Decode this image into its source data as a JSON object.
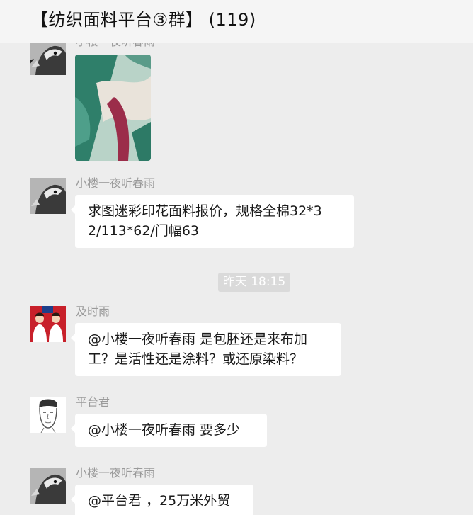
{
  "header": {
    "title": "【纺织面料平台③群】 (119)"
  },
  "colors": {
    "background": "#ededed",
    "bubble": "#ffffff",
    "sender_text": "#9a9a9a",
    "time_badge": "#dadada"
  },
  "messages": [
    {
      "type": "image",
      "sender": "小楼一夜听春雨",
      "avatar": "eagle-avatar"
    },
    {
      "type": "text",
      "sender": "小楼一夜听春雨",
      "avatar": "eagle-avatar",
      "text": "求图迷彩印花面料报价，规格全棉32*3\n2/113*62/门幅63"
    },
    {
      "type": "time",
      "text": "昨天 18:15"
    },
    {
      "type": "text",
      "sender": "及时雨",
      "avatar": "couple-avatar",
      "text": "@小楼一夜听春雨 是包胚还是来布加\n工？是活性还是涂料？或还原染料？"
    },
    {
      "type": "text",
      "sender": "平台君",
      "avatar": "sketch-face-avatar",
      "text": "@小楼一夜听春雨 要多少"
    },
    {
      "type": "text",
      "sender": "小楼一夜听春雨",
      "avatar": "eagle-avatar",
      "text": "@平台君 ，25万米外贸"
    }
  ]
}
